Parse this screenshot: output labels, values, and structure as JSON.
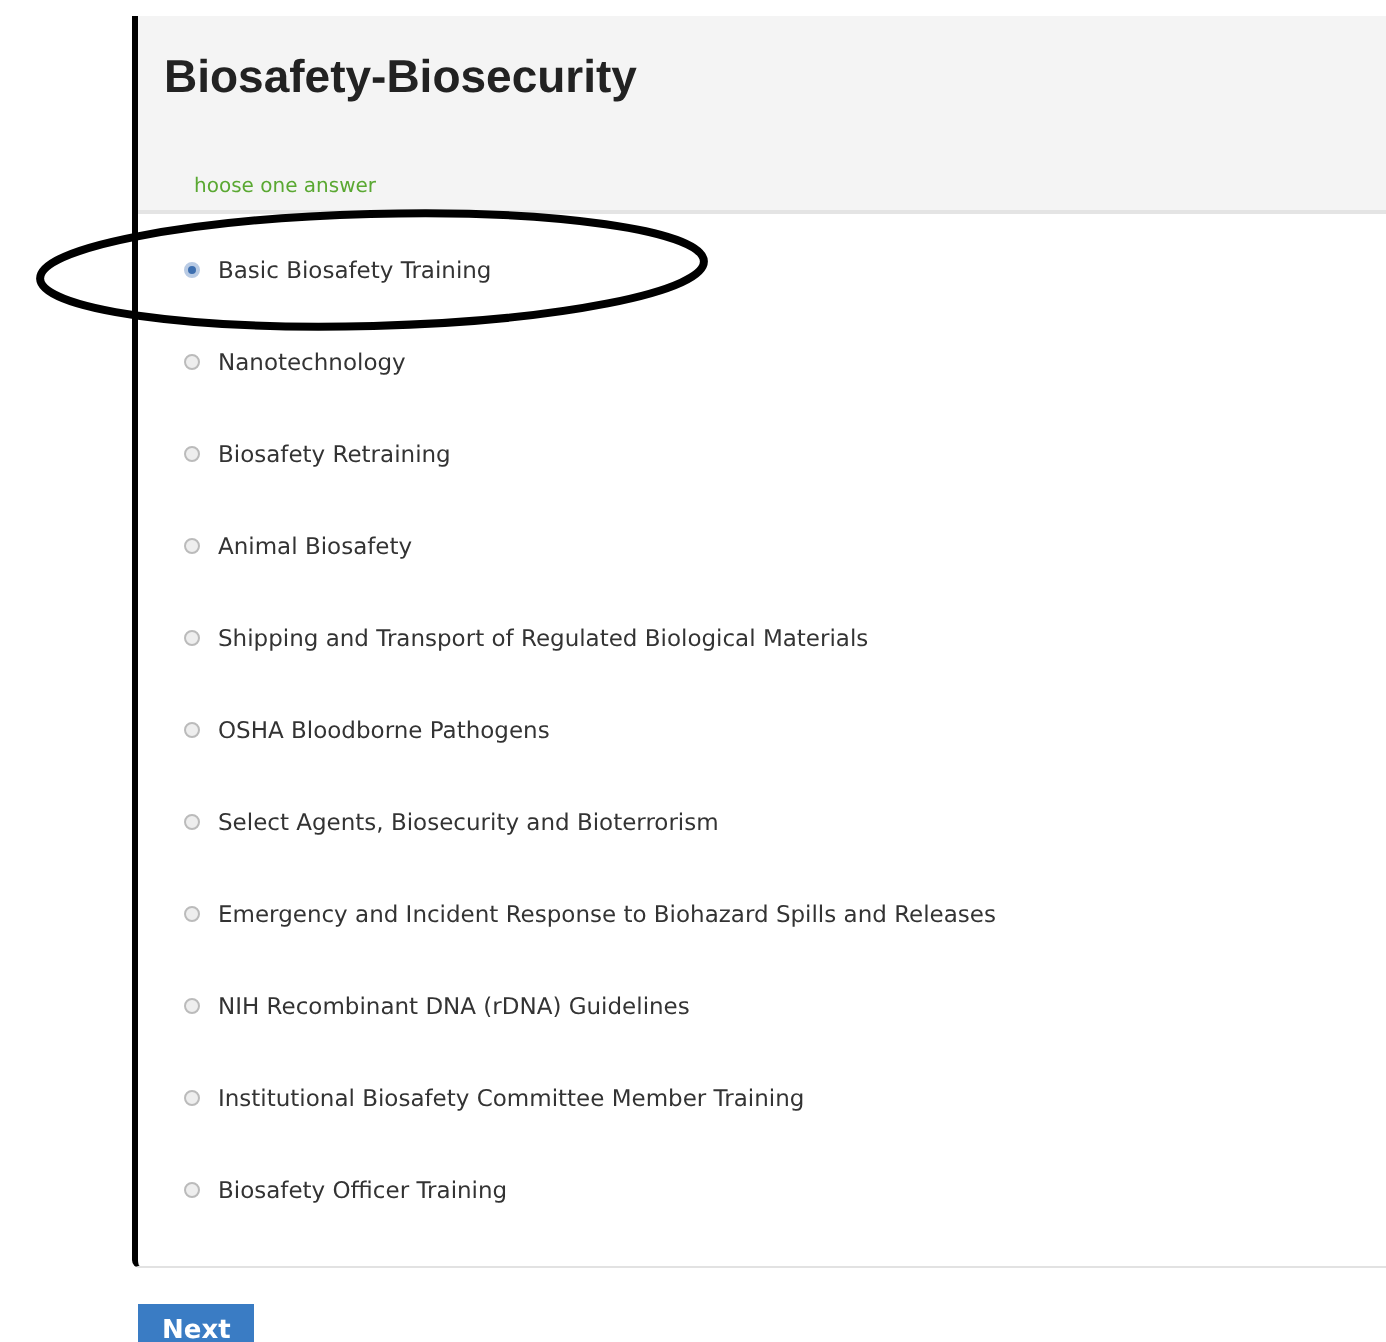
{
  "question": {
    "title": "Biosafety-Biosecurity",
    "hint": "hoose one answer"
  },
  "answers": [
    {
      "label": "Basic Biosafety Training",
      "selected": true
    },
    {
      "label": "Nanotechnology",
      "selected": false
    },
    {
      "label": "Biosafety Retraining",
      "selected": false
    },
    {
      "label": "Animal Biosafety",
      "selected": false
    },
    {
      "label": "Shipping and Transport of Regulated Biological Materials",
      "selected": false
    },
    {
      "label": "OSHA Bloodborne Pathogens",
      "selected": false
    },
    {
      "label": "Select Agents, Biosecurity and Bioterrorism",
      "selected": false
    },
    {
      "label": "Emergency and Incident Response to Biohazard Spills and Releases",
      "selected": false
    },
    {
      "label": "NIH Recombinant DNA (rDNA) Guidelines",
      "selected": false
    },
    {
      "label": "Institutional Biosafety Committee Member Training",
      "selected": false
    },
    {
      "label": "Biosafety Officer Training",
      "selected": false
    }
  ],
  "next_button": "Next"
}
